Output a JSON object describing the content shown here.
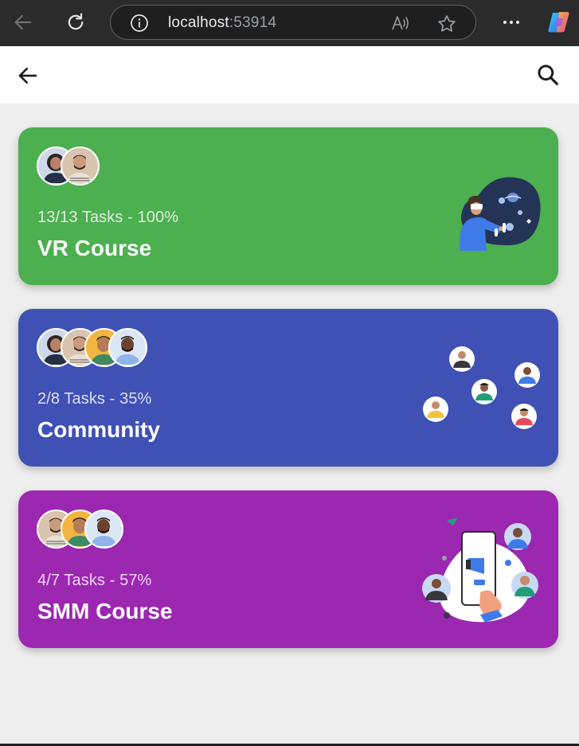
{
  "browser": {
    "url_host": "localhost",
    "url_port": ":53914"
  },
  "colors": {
    "green_card": "#4caf50",
    "indigo_card": "#3f51b5",
    "purple_card": "#9c27b0"
  },
  "appbar": {
    "back_icon": "arrow-back-icon",
    "search_icon": "search-icon"
  },
  "cards": [
    {
      "tasks": "13/13 Tasks - 100%",
      "title": "VR Course",
      "avatar_count": 2,
      "progress": 1.0,
      "illustration": "vr-illustration"
    },
    {
      "tasks": "2/8 Tasks - 35%",
      "title": "Community",
      "avatar_count": 4,
      "progress": 0.35,
      "illustration": "community-illustration"
    },
    {
      "tasks": "4/7 Tasks - 57%",
      "title": "SMM Course",
      "avatar_count": 3,
      "progress": 0.57,
      "illustration": "smm-illustration"
    }
  ]
}
